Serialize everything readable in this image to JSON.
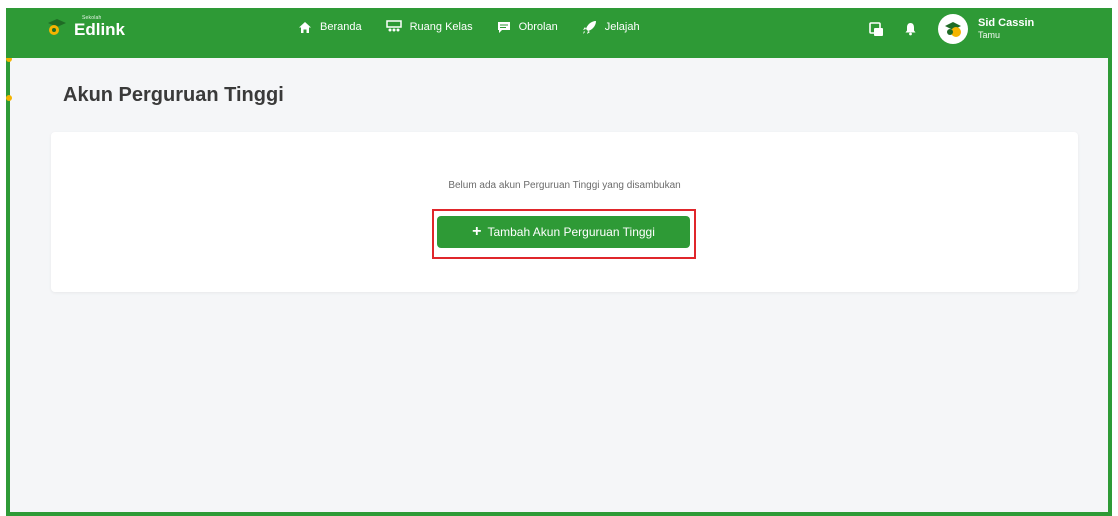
{
  "brand": {
    "name": "Edlink",
    "sub": "Sekolah"
  },
  "nav": {
    "items": [
      {
        "label": "Beranda",
        "icon": "home-icon"
      },
      {
        "label": "Ruang Kelas",
        "icon": "classroom-icon"
      },
      {
        "label": "Obrolan",
        "icon": "chat-icon"
      },
      {
        "label": "Jelajah",
        "icon": "rocket-icon"
      }
    ]
  },
  "tools": {
    "icons": [
      "card-switch-icon",
      "bell-icon"
    ]
  },
  "user": {
    "name": "Sid Cassin",
    "role": "Tamu"
  },
  "page": {
    "title": "Akun Perguruan Tinggi"
  },
  "empty_state": {
    "message": "Belum ada akun Perguruan Tinggi yang disambukan",
    "button_label": "Tambah Akun Perguruan Tinggi",
    "button_icon": "plus-icon"
  },
  "colors": {
    "primary": "#2e9a36",
    "highlight": "#e0262b",
    "accent": "#f4b400"
  }
}
